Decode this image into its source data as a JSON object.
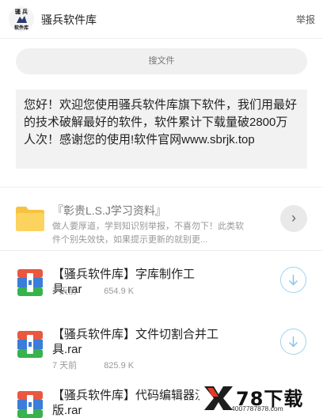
{
  "header": {
    "logo_text_top": "骚 兵",
    "logo_text_bottom": "软件库",
    "title": "骚兵软件库",
    "report_label": "举报"
  },
  "search": {
    "placeholder": "搜文件"
  },
  "notice": {
    "text": "您好！欢迎您使用骚兵软件库旗下软件，我们用最好的技术破解最好的软件，软件累计下载量破2800万人次！感谢您的使用!软件官网www.sbrjk.top"
  },
  "folder": {
    "title": "『彰贵L.S.J学习资料』",
    "description": "做人要厚道，学到知识别举报，不喜勿下！此类软件个别失效快，如果提示更新的就别更..."
  },
  "files": [
    {
      "name": "【骚兵软件库】字库制作工具.rar",
      "time": "7 天前",
      "size": "654.9 K"
    },
    {
      "name": "【骚兵软件库】文件切割合并工具.rar",
      "time": "7 天前",
      "size": "825.9 K"
    },
    {
      "name": "【骚兵软件库】代码编辑器汉化版.rar"
    }
  ],
  "watermark": {
    "text": "78下载",
    "sub": "4007787878.com"
  },
  "colors": {
    "folder": "#f7c243",
    "download_ring": "#9fd3ef",
    "accent": "#2b95d6"
  }
}
